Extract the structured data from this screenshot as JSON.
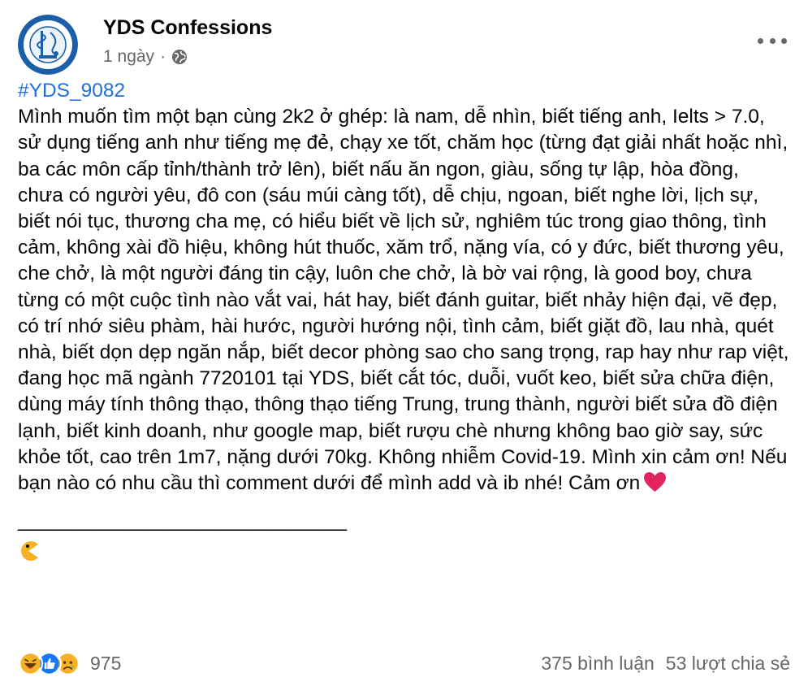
{
  "post": {
    "page_name": "YDS Confessions",
    "time": "1 ngày",
    "separator": "·",
    "audience_icon": "globe-icon",
    "hashtag": "#YDS_9082",
    "text": "Mình muốn tìm một bạn cùng 2k2 ở ghép: là nam, dễ nhìn, biết tiếng anh, Ielts > 7.0, sử dụng tiếng anh như tiếng mẹ đẻ, chạy xe tốt, chăm học (từng đạt giải nhất hoặc nhì, ba các môn cấp tỉnh/thành trở lên), biết nấu ăn ngon,   giàu, sống tự lập, hòa đồng, chưa có người yêu, đô con (sáu múi càng tốt), dễ chịu, ngoan, biết nghe lời, lịch sự, biết nói tục, thương cha mẹ, có hiểu biết về lịch sử, nghiêm túc trong giao thông, tình cảm, không xài đồ hiệu, không hút thuốc, xăm trổ, nặng vía, có y đức, biết thương yêu, che chở, là một người đáng tin cậy, luôn che chở, là bờ vai rộng, là good boy, chưa từng có một cuộc tình nào vắt vai, hát hay, biết đánh guitar, biết nhảy hiện đại, vẽ đẹp, có trí nhớ siêu phàm, hài hước, người hướng nội, tình cảm, biết giặt đồ, lau nhà, quét nhà, biết dọn dẹp ngăn nắp, biết decor phòng sao cho sang trọng, rap hay như rap việt, đang học mã ngành 7720101 tại YDS, biết cắt tóc, duỗi, vuốt keo, biết sửa chữa điện, dùng máy tính thông thạo, thông thạo tiếng Trung, trung thành, người biết sửa đồ điện lạnh, biết kinh doanh, như google map, biết rượu chè nhưng không bao giờ say, sức khỏe tốt, cao trên 1m7, nặng dưới 70kg. Không nhiễm Covid-19. Mình xin cảm ơn! Nếu bạn nào có nhu cầu thì comment dưới để mình add và ib nhé! Cảm ơn",
    "divider": "________________________________",
    "emoji_icons": [
      "heart-icon",
      "pacman-icon"
    ]
  },
  "stats": {
    "reactions": [
      "haha-icon",
      "like-icon",
      "sad-icon"
    ],
    "reaction_count": "975",
    "comments": "375 bình luận",
    "shares": "53 lượt chia sẻ"
  },
  "colors": {
    "hashtag": "#216fdb",
    "secondary_text": "#65676b",
    "heart": "#e0245e",
    "like": "#1877f2",
    "emoji_yellow": "#f7b125"
  }
}
